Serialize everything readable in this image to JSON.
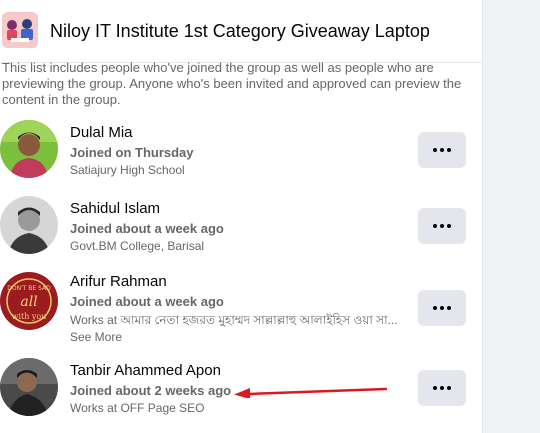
{
  "group": {
    "name": "Niloy IT Institute 1st Category Giveaway Laptop",
    "description": "This list includes people who've joined the group as well as people who are previewing the group. Anyone who's been invited and approved can preview the content in the group."
  },
  "members": [
    {
      "name": "Dulal Mia",
      "joined": "Joined on Thursday",
      "detail": "Satiajury High School",
      "see_more": ""
    },
    {
      "name": "Sahidul Islam",
      "joined": "Joined about a week ago",
      "detail": "Govt.BM College, Barisal",
      "see_more": ""
    },
    {
      "name": "Arifur Rahman",
      "joined": "Joined about a week ago",
      "detail": "Works at আমার নেতা হজরত মুহাম্মদ সাল্লাল্লাহু আলাইহিস ওয়া সা...",
      "see_more": "See More"
    },
    {
      "name": "Tanbir Ahammed Apon",
      "joined": "Joined about 2 weeks ago",
      "detail": "Works at OFF Page SEO",
      "see_more": ""
    }
  ],
  "icons": {
    "more": "more-horizontal-icon",
    "annotation": "red-arrow-annotation"
  },
  "colors": {
    "annotation_arrow": "#e0181b",
    "button_bg": "#e4e6eb",
    "secondary_text": "#65676b"
  }
}
